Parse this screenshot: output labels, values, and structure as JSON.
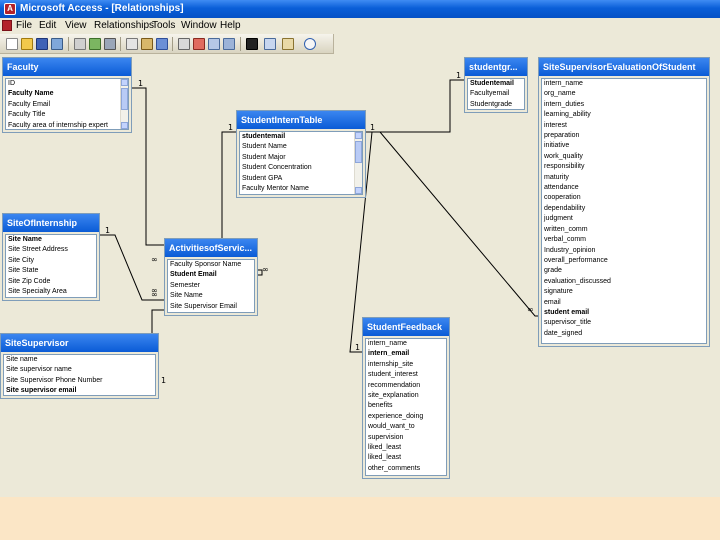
{
  "window": {
    "title": "Microsoft Access - [Relationships]",
    "icon_label": "A"
  },
  "menubar": {
    "items": [
      "File",
      "Edit",
      "View",
      "Relationships",
      "Tools",
      "Window",
      "Help"
    ]
  },
  "toolbar": {
    "buttons": [
      "new-icon",
      "open-icon",
      "save-icon",
      "print-preview-icon",
      "print-icon",
      "spell-check-icon",
      "cut-icon",
      "copy-icon",
      "paste-icon",
      "undo-icon",
      "show-table-icon",
      "clear-layout-icon",
      "show-direct-icon",
      "show-all-icon",
      "delete-icon",
      "database-window-icon",
      "new-object-icon",
      "help-icon"
    ]
  },
  "tables": {
    "faculty": {
      "title": "Faculty",
      "fields": [
        {
          "name": "ID",
          "key": false
        },
        {
          "name": "Faculty Name",
          "key": true
        },
        {
          "name": "Faculty Email",
          "key": false
        },
        {
          "name": "Faculty Title",
          "key": false
        },
        {
          "name": "Faculty area of internship expert",
          "key": false
        }
      ]
    },
    "student_intern": {
      "title": "StudentInternTable",
      "fields": [
        {
          "name": "studentemail",
          "key": true
        },
        {
          "name": "Student Name",
          "key": false
        },
        {
          "name": "Student Major",
          "key": false
        },
        {
          "name": "Student Concentration",
          "key": false
        },
        {
          "name": "Student GPA",
          "key": false
        },
        {
          "name": "Faculty Mentor Name",
          "key": false
        }
      ]
    },
    "student_gr": {
      "title": "studentgr...",
      "fields": [
        {
          "name": "Studentemail",
          "key": true
        },
        {
          "name": "Facultyemail",
          "key": false
        },
        {
          "name": "Studentgrade",
          "key": false
        }
      ]
    },
    "site_eval": {
      "title": "SiteSupervisorEvaluationOfStudent",
      "fields": [
        {
          "name": "intern_name",
          "key": false
        },
        {
          "name": "org_name",
          "key": false
        },
        {
          "name": "intern_duties",
          "key": false
        },
        {
          "name": "learning_ability",
          "key": false
        },
        {
          "name": "interest",
          "key": false
        },
        {
          "name": "preparation",
          "key": false
        },
        {
          "name": "initiative",
          "key": false
        },
        {
          "name": "work_quality",
          "key": false
        },
        {
          "name": "responsibility",
          "key": false
        },
        {
          "name": "maturity",
          "key": false
        },
        {
          "name": "attendance",
          "key": false
        },
        {
          "name": "cooperation",
          "key": false
        },
        {
          "name": "dependability",
          "key": false
        },
        {
          "name": "judgment",
          "key": false
        },
        {
          "name": "written_comm",
          "key": false
        },
        {
          "name": "verbal_comm",
          "key": false
        },
        {
          "name": "Industry_opinion",
          "key": false
        },
        {
          "name": "overall_performance",
          "key": false
        },
        {
          "name": "grade",
          "key": false
        },
        {
          "name": "evaluation_discussed",
          "key": false
        },
        {
          "name": "signature",
          "key": false
        },
        {
          "name": "email",
          "key": false
        },
        {
          "name": "student email",
          "key": true
        },
        {
          "name": "supervisor_title",
          "key": false
        },
        {
          "name": "date_signed",
          "key": false
        }
      ]
    },
    "site_internship": {
      "title": "SiteOfInternship",
      "fields": [
        {
          "name": "Site Name",
          "key": true
        },
        {
          "name": "Site Street Address",
          "key": false
        },
        {
          "name": "Site City",
          "key": false
        },
        {
          "name": "Site State",
          "key": false
        },
        {
          "name": "Site Zip Code",
          "key": false
        },
        {
          "name": "Site Specialty Area",
          "key": false
        }
      ]
    },
    "activities": {
      "title": "ActivitiesofServic...",
      "fields": [
        {
          "name": "Faculty Sponsor Name",
          "key": false
        },
        {
          "name": "Student Email",
          "key": true
        },
        {
          "name": "Semester",
          "key": false
        },
        {
          "name": "Site Name",
          "key": false
        },
        {
          "name": "Site Supervisor Email",
          "key": false
        }
      ]
    },
    "site_supervisor": {
      "title": "SiteSupervisor",
      "fields": [
        {
          "name": "Site name",
          "key": false
        },
        {
          "name": "Site supervisor name",
          "key": false
        },
        {
          "name": "Site Supervisor Phone Number",
          "key": false
        },
        {
          "name": "Site supervisor email",
          "key": true
        }
      ]
    },
    "student_feedback": {
      "title": "StudentFeedback",
      "fields": [
        {
          "name": "intern_name",
          "key": false
        },
        {
          "name": "intern_email",
          "key": true
        },
        {
          "name": "internship_site",
          "key": false
        },
        {
          "name": "student_interest",
          "key": false
        },
        {
          "name": "recommendation",
          "key": false
        },
        {
          "name": "site_explanation",
          "key": false
        },
        {
          "name": "benefits",
          "key": false
        },
        {
          "name": "experience_doing",
          "key": false
        },
        {
          "name": "would_want_to",
          "key": false
        },
        {
          "name": "supervision",
          "key": false
        },
        {
          "name": "liked_least",
          "key": false
        },
        {
          "name": "liked_least",
          "key": false
        },
        {
          "name": "other_comments",
          "key": false
        }
      ]
    }
  },
  "relationships": {
    "one": "1",
    "many": "∞"
  }
}
